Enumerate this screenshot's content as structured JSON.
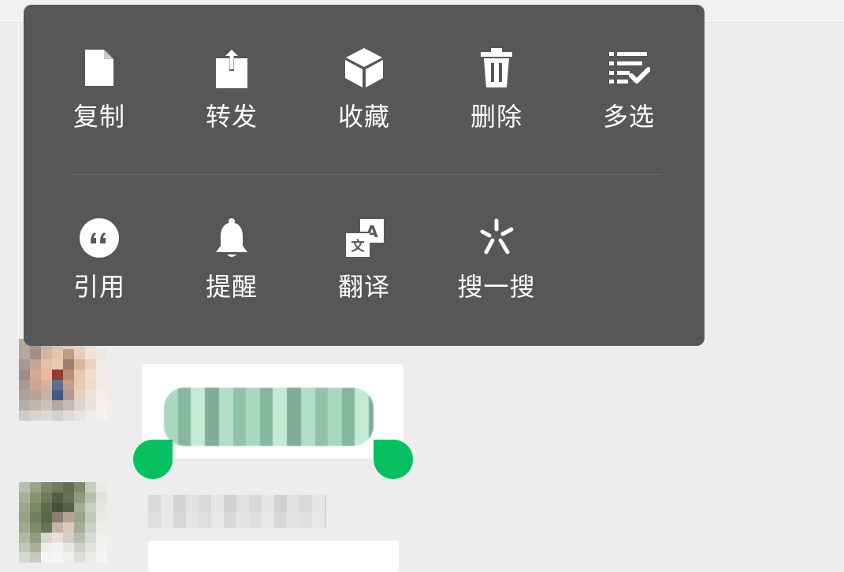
{
  "menu": {
    "row1": [
      {
        "label": "复制",
        "icon": "document-icon"
      },
      {
        "label": "转发",
        "icon": "share-icon"
      },
      {
        "label": "收藏",
        "icon": "cube-icon"
      },
      {
        "label": "删除",
        "icon": "trash-icon"
      },
      {
        "label": "多选",
        "icon": "multiselect-icon"
      }
    ],
    "row2": [
      {
        "label": "引用",
        "icon": "quote-icon"
      },
      {
        "label": "提醒",
        "icon": "bell-icon"
      },
      {
        "label": "翻译",
        "icon": "translate-icon"
      },
      {
        "label": "搜一搜",
        "icon": "search-spark-icon"
      }
    ]
  },
  "colors": {
    "menu_bg": "#575757",
    "accent": "#07c160",
    "background": "#ededed"
  }
}
